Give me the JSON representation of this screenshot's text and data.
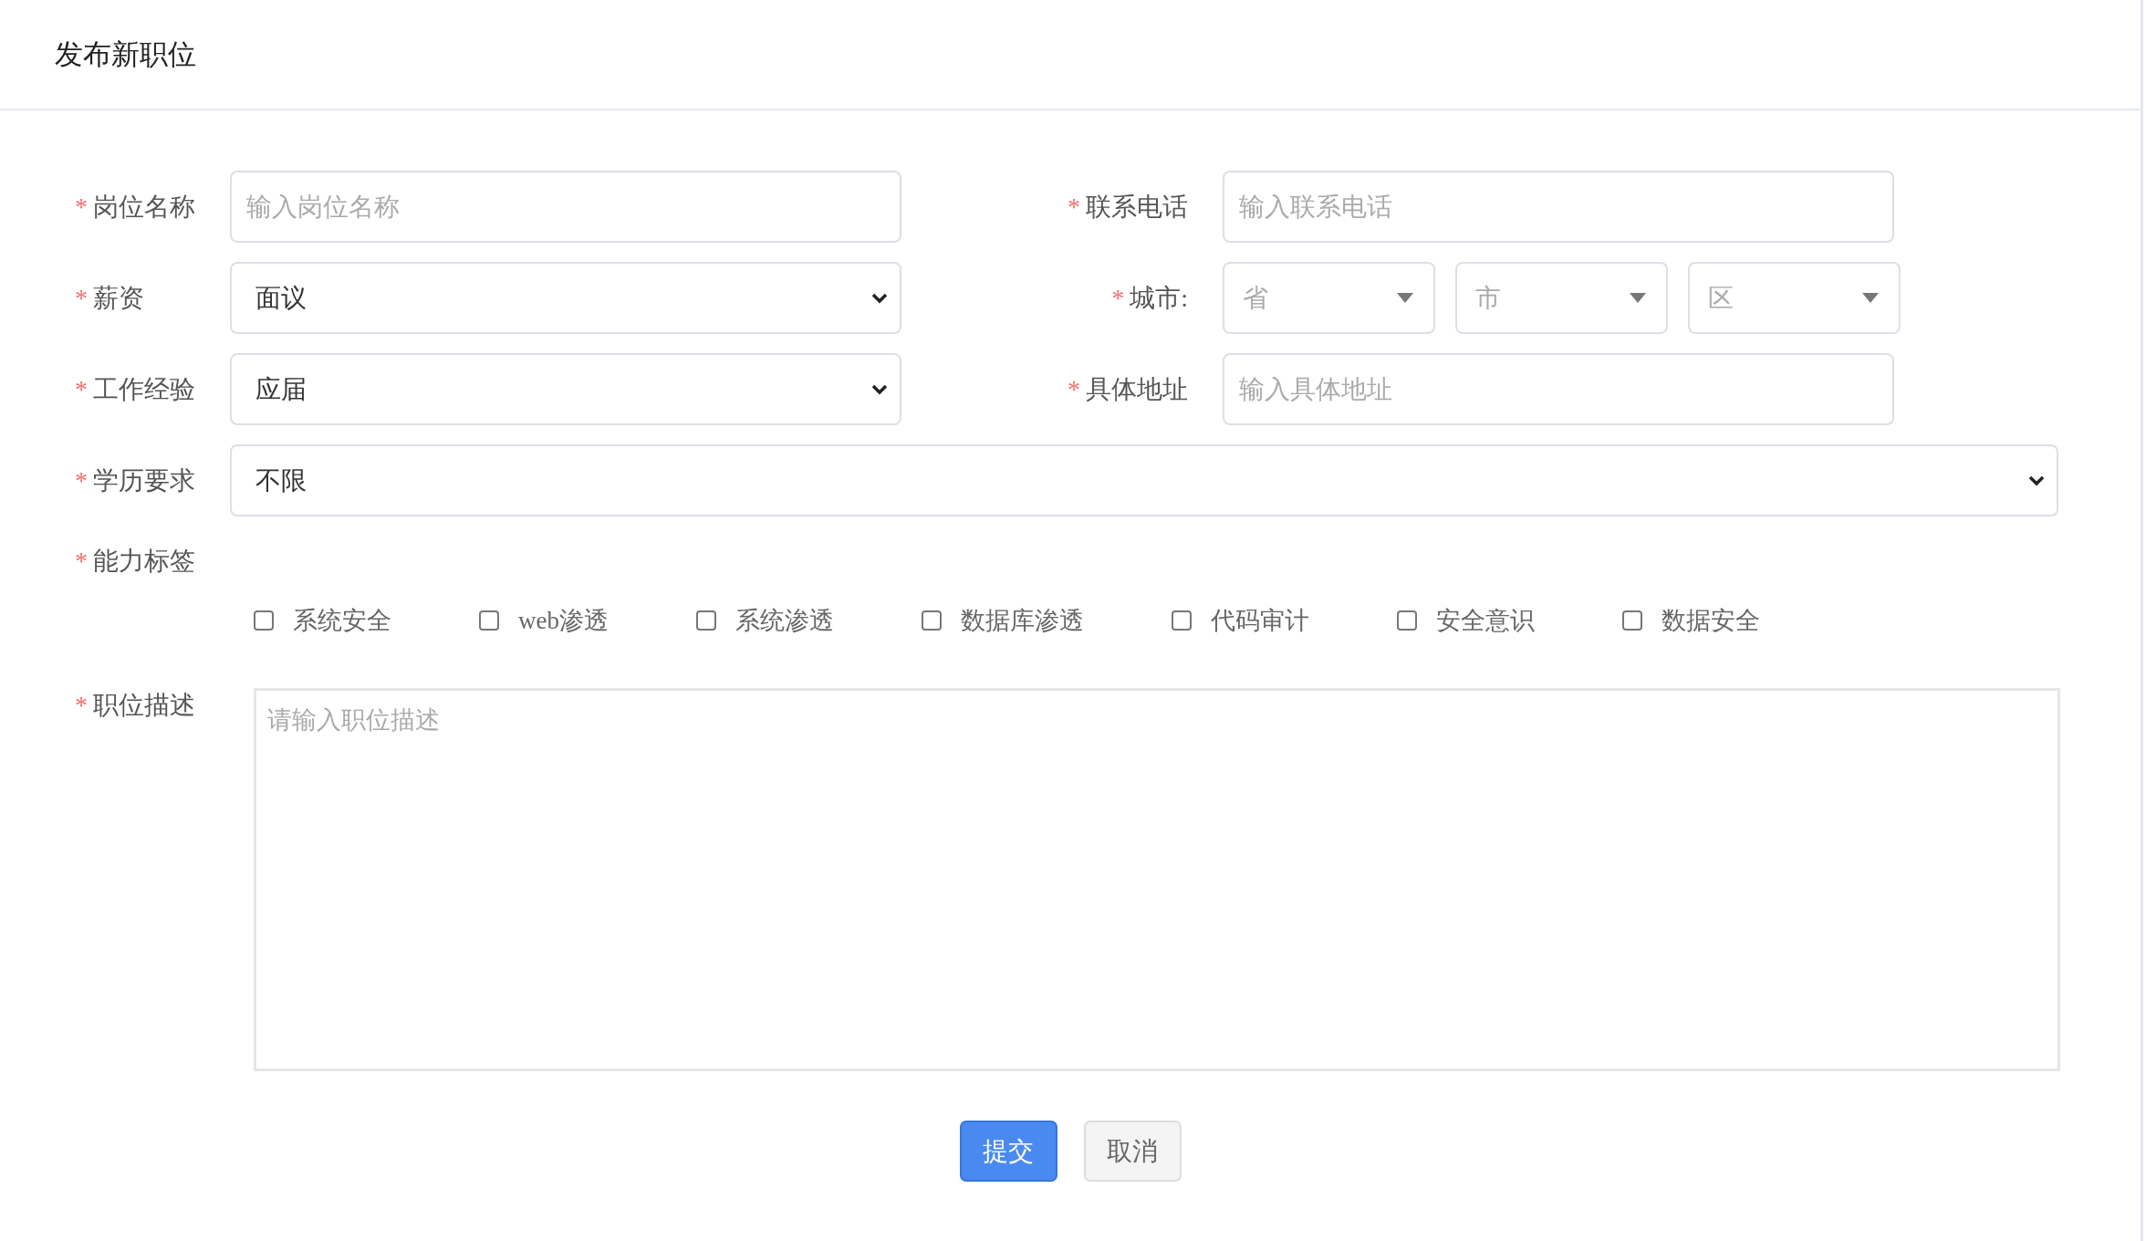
{
  "title": "发布新职位",
  "rows": [
    [
      {
        "kind": "input",
        "mark": "*",
        "label": "岗位名称",
        "placeholder": "输入岗位名称"
      },
      {
        "kind": "input",
        "mark": "*",
        "label": "联系电话",
        "placeholder": "输入联系电话"
      }
    ],
    [
      {
        "kind": "select",
        "mark": "*",
        "label": "薪资",
        "value": "面议"
      },
      {
        "kind": "cascade",
        "mark": "*",
        "label": "城市:",
        "selects": [
          {
            "placeholder": "省"
          },
          {
            "placeholder": "市"
          },
          {
            "placeholder": "区"
          }
        ]
      }
    ],
    [
      {
        "kind": "select",
        "mark": "*",
        "label": "工作经验",
        "value": "应届"
      },
      {
        "kind": "input",
        "mark": "*",
        "label": "具体地址",
        "placeholder": "输入具体地址"
      }
    ],
    [
      {
        "kind": "select",
        "mark": "*",
        "label": "学历要求",
        "value": "不限"
      }
    ],
    [
      {
        "kind": "tags",
        "mark": "*",
        "label": "能力标签",
        "options": [
          {
            "label": "系统安全",
            "checked": false
          },
          {
            "label": "web渗透",
            "checked": false
          },
          {
            "label": "系统渗透",
            "checked": false
          },
          {
            "label": "数据库渗透",
            "checked": false
          },
          {
            "label": "代码审计",
            "checked": false
          },
          {
            "label": "安全意识",
            "checked": false
          },
          {
            "label": "数据安全",
            "checked": false
          }
        ]
      }
    ],
    [
      {
        "kind": "textarea",
        "mark": "*",
        "label": "职位描述",
        "placeholder": "请输入职位描述"
      }
    ]
  ],
  "buttons": [
    {
      "label": "提交",
      "kind": "primary"
    },
    {
      "label": "取消",
      "kind": "default"
    }
  ]
}
